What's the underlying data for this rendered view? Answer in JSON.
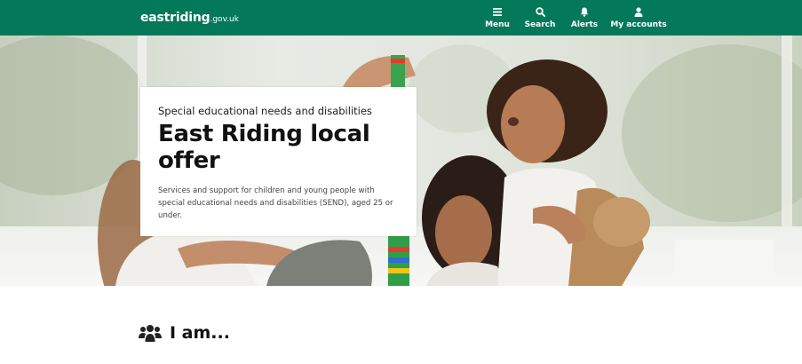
{
  "header": {
    "logo_main": "eastriding",
    "logo_suffix": ".gov.uk",
    "nav": [
      {
        "label": "Menu",
        "icon": "hamburger-icon"
      },
      {
        "label": "Search",
        "icon": "search-icon"
      },
      {
        "label": "Alerts",
        "icon": "bell-icon"
      },
      {
        "label": "My accounts",
        "icon": "user-icon"
      }
    ],
    "brand_color": "#04795a"
  },
  "hero": {
    "kicker": "Special educational needs and disabilities",
    "title": "East Riding local offer",
    "description": "Services and support for children and young people with special educational needs and disabilities (SEND), aged 25 or under."
  },
  "section": {
    "heading": "I am...",
    "icon": "users-icon"
  }
}
